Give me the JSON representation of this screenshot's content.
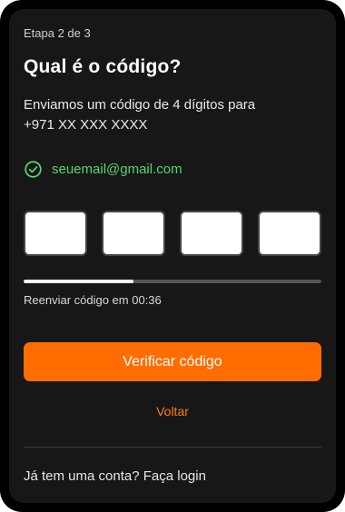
{
  "header": {
    "step_label": "Etapa 2 de 3",
    "title": "Qual é o código?",
    "subtitle_line1": "Enviamos um código de 4 dígitos para",
    "subtitle_line2": "+971 XX XXX XXXX"
  },
  "email": {
    "address": "seuemail@gmail.com",
    "icon": "check-circle-icon",
    "color": "#56d66e"
  },
  "code": {
    "digits": [
      "",
      "",
      "",
      ""
    ]
  },
  "timer": {
    "progress_fraction": 0.37,
    "resend_label": "Reenviar código em 00:36"
  },
  "actions": {
    "verify_label": "Verificar código",
    "back_label": "Voltar",
    "accent_color": "#ff6d00"
  },
  "footer": {
    "login_prompt": "Já tem uma conta? ",
    "login_link": "Faça login"
  }
}
